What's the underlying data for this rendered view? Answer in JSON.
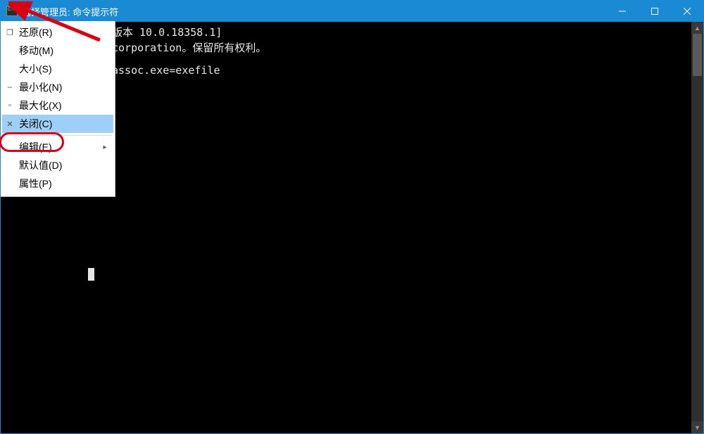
{
  "titlebar": {
    "title": "选择管理员: 命令提示符"
  },
  "console": {
    "line1_fragment": "版本 10.0.18358.1]",
    "line2_fragment": "corporation。保留所有权利。",
    "line3_blank": "",
    "line4_fragment": "assoc.exe=exefile"
  },
  "sysmenu": {
    "items": [
      {
        "icon": "restore-icon",
        "glyph": "❐",
        "label": "还原(R)",
        "enabled": true,
        "selected": false,
        "submenu": false
      },
      {
        "icon": "",
        "glyph": "",
        "label": "移动(M)",
        "enabled": true,
        "selected": false,
        "submenu": false
      },
      {
        "icon": "",
        "glyph": "",
        "label": "大小(S)",
        "enabled": true,
        "selected": false,
        "submenu": false
      },
      {
        "icon": "minimize-icon",
        "glyph": "–",
        "label": "最小化(N)",
        "enabled": true,
        "selected": false,
        "submenu": false
      },
      {
        "icon": "maximize-icon",
        "glyph": "▫",
        "label": "最大化(X)",
        "enabled": true,
        "selected": false,
        "submenu": false
      },
      {
        "icon": "close-icon",
        "glyph": "✕",
        "label": "关闭(C)",
        "enabled": true,
        "selected": true,
        "submenu": false
      },
      {
        "separator": true
      },
      {
        "icon": "",
        "glyph": "",
        "label": "编辑(E)",
        "enabled": true,
        "selected": false,
        "submenu": true
      },
      {
        "icon": "",
        "glyph": "",
        "label": "默认值(D)",
        "enabled": true,
        "selected": false,
        "submenu": false
      },
      {
        "icon": "",
        "glyph": "",
        "label": "属性(P)",
        "enabled": true,
        "selected": false,
        "submenu": false
      }
    ]
  }
}
